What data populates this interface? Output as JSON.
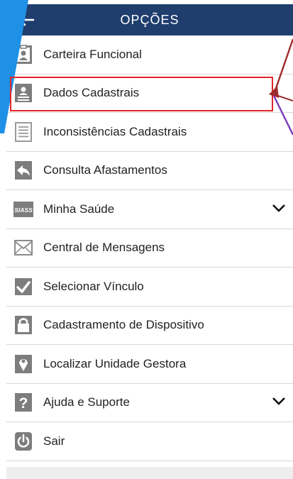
{
  "header": {
    "back_icon": "arrow-left-icon",
    "title": "OPÇÕES"
  },
  "menu": {
    "items": [
      {
        "label": "Carteira Funcional",
        "icon": "id-card-icon",
        "expandable": false
      },
      {
        "label": "Dados Cadastrais",
        "icon": "profile-document-icon",
        "expandable": false,
        "highlighted": true
      },
      {
        "label": "Inconsistências Cadastrais",
        "icon": "document-list-icon",
        "expandable": false
      },
      {
        "label": "Consulta Afastamentos",
        "icon": "reply-arrow-icon",
        "expandable": false
      },
      {
        "label": "Minha Saúde",
        "icon": "siass-icon",
        "icon_text": "SIASS",
        "expandable": true
      },
      {
        "label": "Central de Mensagens",
        "icon": "envelope-icon",
        "expandable": false
      },
      {
        "label": "Selecionar Vínculo",
        "icon": "checkmark-icon",
        "expandable": false
      },
      {
        "label": "Cadastramento de Dispositivo",
        "icon": "padlock-icon",
        "expandable": false
      },
      {
        "label": "Localizar Unidade Gestora",
        "icon": "map-pin-icon",
        "expandable": false
      },
      {
        "label": "Ajuda e Suporte",
        "icon": "question-mark-icon",
        "icon_text": "?",
        "expandable": true
      },
      {
        "label": "Sair",
        "icon": "power-icon",
        "expandable": false
      }
    ]
  },
  "colors": {
    "header_bg": "#1f3e6e",
    "icon_gray": "#7d7d7d",
    "highlight_border": "#e0262a",
    "annotation_dark_red": "#9e2b2b",
    "annotation_purple": "#7a3db8",
    "decor_blue": "#1e90e6"
  }
}
